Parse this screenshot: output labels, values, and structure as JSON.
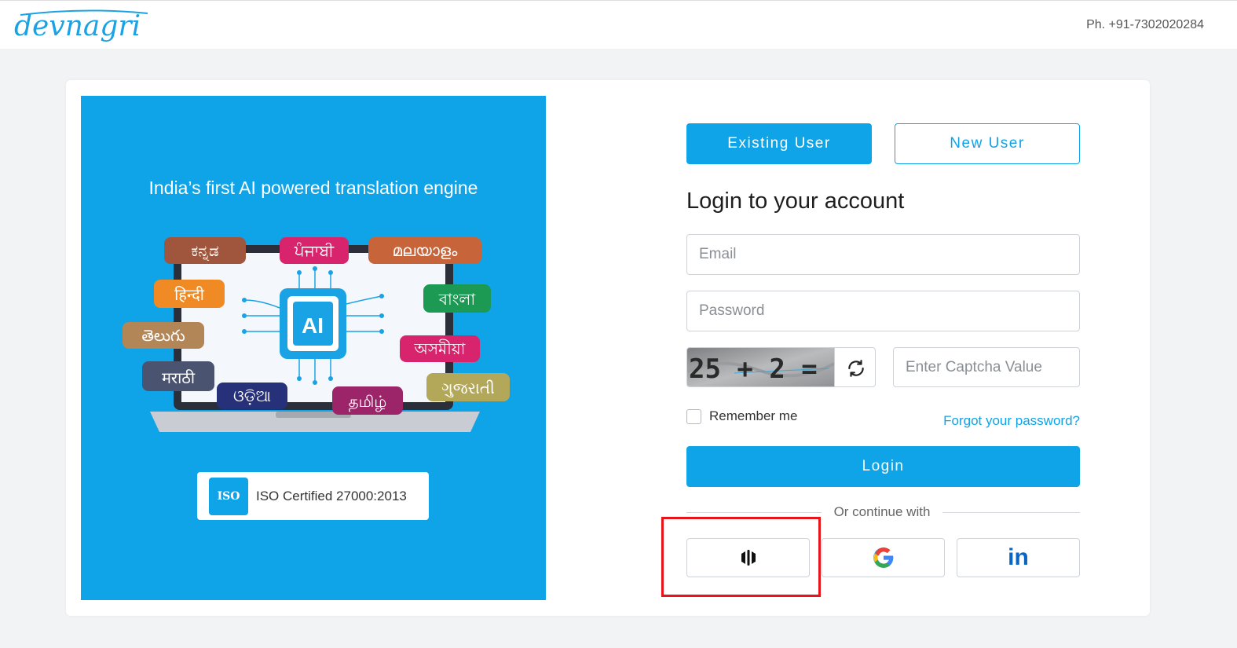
{
  "header": {
    "logo_text": "devnagri",
    "phone": "Ph. +91-7302020284"
  },
  "promo": {
    "title": "India’s first AI powered translation engine",
    "illustration_labels": {
      "center": "AI",
      "languages": [
        "ಕನ್ನಡ",
        "ਪੰਜਾਬੀ",
        "മലയാളം",
        "हिन्दी",
        "বাংলা",
        "తెలుగు",
        "অসমীয়া",
        "मराठी",
        "ଓଡ଼ିଆ",
        "தமிழ்",
        "ગુજરાતી"
      ]
    },
    "iso_badge": "ISO",
    "iso_text": "ISO Certified 27000:2013"
  },
  "tabs": {
    "existing_label": "Existing User",
    "new_label": "New User"
  },
  "login": {
    "heading": "Login to your account",
    "email_placeholder": "Email",
    "password_placeholder": "Password",
    "captcha_text": "25 + 2 =",
    "captcha_placeholder": "Enter Captcha Value",
    "remember_label": "Remember me",
    "forgot_label": "Forgot your password?",
    "login_label": "Login",
    "or_text": "Or continue with"
  },
  "social": {
    "first_icon": "brand-logo-icon",
    "second_icon": "google-icon",
    "third_icon": "linkedin-icon",
    "third_text": "in"
  },
  "colors": {
    "accent": "#0ea4e7",
    "highlight": "#e8141b",
    "background": "#f2f3f5"
  }
}
